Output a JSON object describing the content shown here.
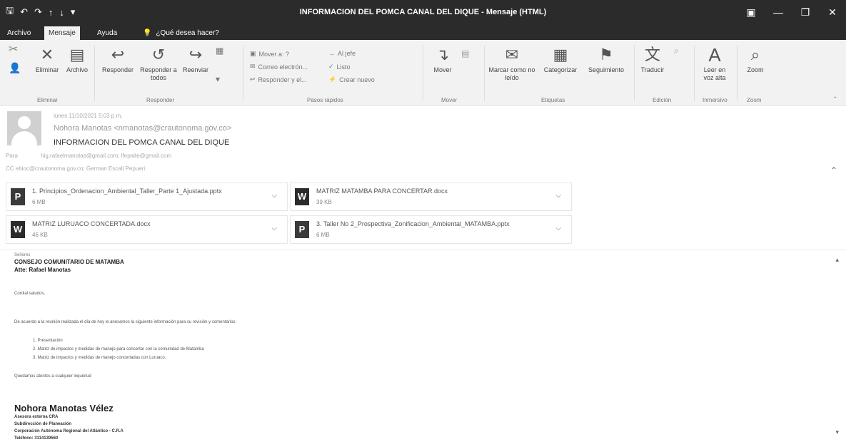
{
  "window": {
    "title": "INFORMACION DEL POMCA CANAL DEL DIQUE  -  Mensaje (HTML)",
    "icons": [
      "save-icon",
      "undo-icon",
      "redo-icon",
      "up-arrow-icon",
      "down-arrow-icon",
      "customize-icon"
    ]
  },
  "tabs": [
    {
      "label": "Archivo"
    },
    {
      "label": "Mensaje"
    },
    {
      "label": "Ayuda"
    }
  ],
  "tellme": {
    "placeholder": "¿Qué desea hacer?"
  },
  "ribbon": {
    "eliminar": {
      "label": "Eliminar",
      "archivo": "Archivo",
      "group": "Eliminar"
    },
    "responder": {
      "responder": "Responder",
      "responder_todos": "Responder a todos",
      "reenviar": "Reenviar",
      "group": "Responder"
    },
    "pasos": {
      "items": [
        "Mover a: ?",
        "Correo electrón...",
        "Responder y el...",
        "Al jefe",
        "Listo",
        "Crear nuevo"
      ],
      "group": "Pasos rápidos"
    },
    "mover": {
      "label": "Mover",
      "group": "Mover"
    },
    "etiquetas": {
      "marcar": "Marcar como no leído",
      "categorizar": "Categorizar",
      "seguimiento": "Seguimiento",
      "group": "Etiquetas"
    },
    "edicion": {
      "traducir": "Traducir",
      "group": "Edición"
    },
    "inmersivo": {
      "leer": "Leer en voz alta",
      "group": "Inmersivo"
    },
    "zoom": {
      "label": "Zoom",
      "group": "Zoom"
    }
  },
  "message": {
    "date": "lunes 11/10/2021 5:03 p.m.",
    "from": "Nohora Manotas <nmanotas@crautonoma.gov.co>",
    "subject": "INFORMACION DEL POMCA CANAL DEL DIQUE",
    "to_label": "Para",
    "to": "hig.rafaelmanotas@gmail.com;  lfepaite@gmail.com",
    "cc": "CC   ebioc@crautonoma.gov.co;   German Escall Pepueri"
  },
  "attachments": [
    {
      "name": "1. Principios_Ordenacion_Ambiental_Taller_Parte 1_Ajustada.pptx",
      "size": "6 MB",
      "type": "ppt"
    },
    {
      "name": "MATRIZ MATAMBA PARA CONCERTAR.docx",
      "size": "39 KB",
      "type": "doc"
    },
    {
      "name": "MATRIZ LURUACO CONCERTADA.docx",
      "size": "46 KB",
      "type": "doc"
    },
    {
      "name": "3. Taller No 2_Prospectiva_Zonificacion_Ambiental_MATAMBA.pptx",
      "size": "6 MB",
      "type": "ppt"
    }
  ],
  "body": {
    "salutation_small": "Señores",
    "org": "CONSEJO COMUNITARIO DE MATAMBA",
    "attn": "Atte: Rafael Manotas",
    "greeting": "Cordial saludos,",
    "intro": "De acuerdo a la reunión realizada el día de hoy le anexamos la siguiente información para su revisión y comentarios:",
    "list": [
      "1.   Presentación",
      "2.   Matriz de impactos y medidas de manejo para concertar con la comunidad de Matamba",
      "3.   Matriz de impactos y medidas de manejo concertadas con Luruaco."
    ],
    "closing": "Quedamos atentos a cualquier  inquietud",
    "signature": {
      "name": "Nohora Manotas Vélez",
      "role": "Asesora externa CRA",
      "dept": "Subdirección de Planeación",
      "org": "Corporación Autónoma Regional del Atlántico - C.R.A",
      "phone": "Teléfono: 3114139560"
    }
  }
}
